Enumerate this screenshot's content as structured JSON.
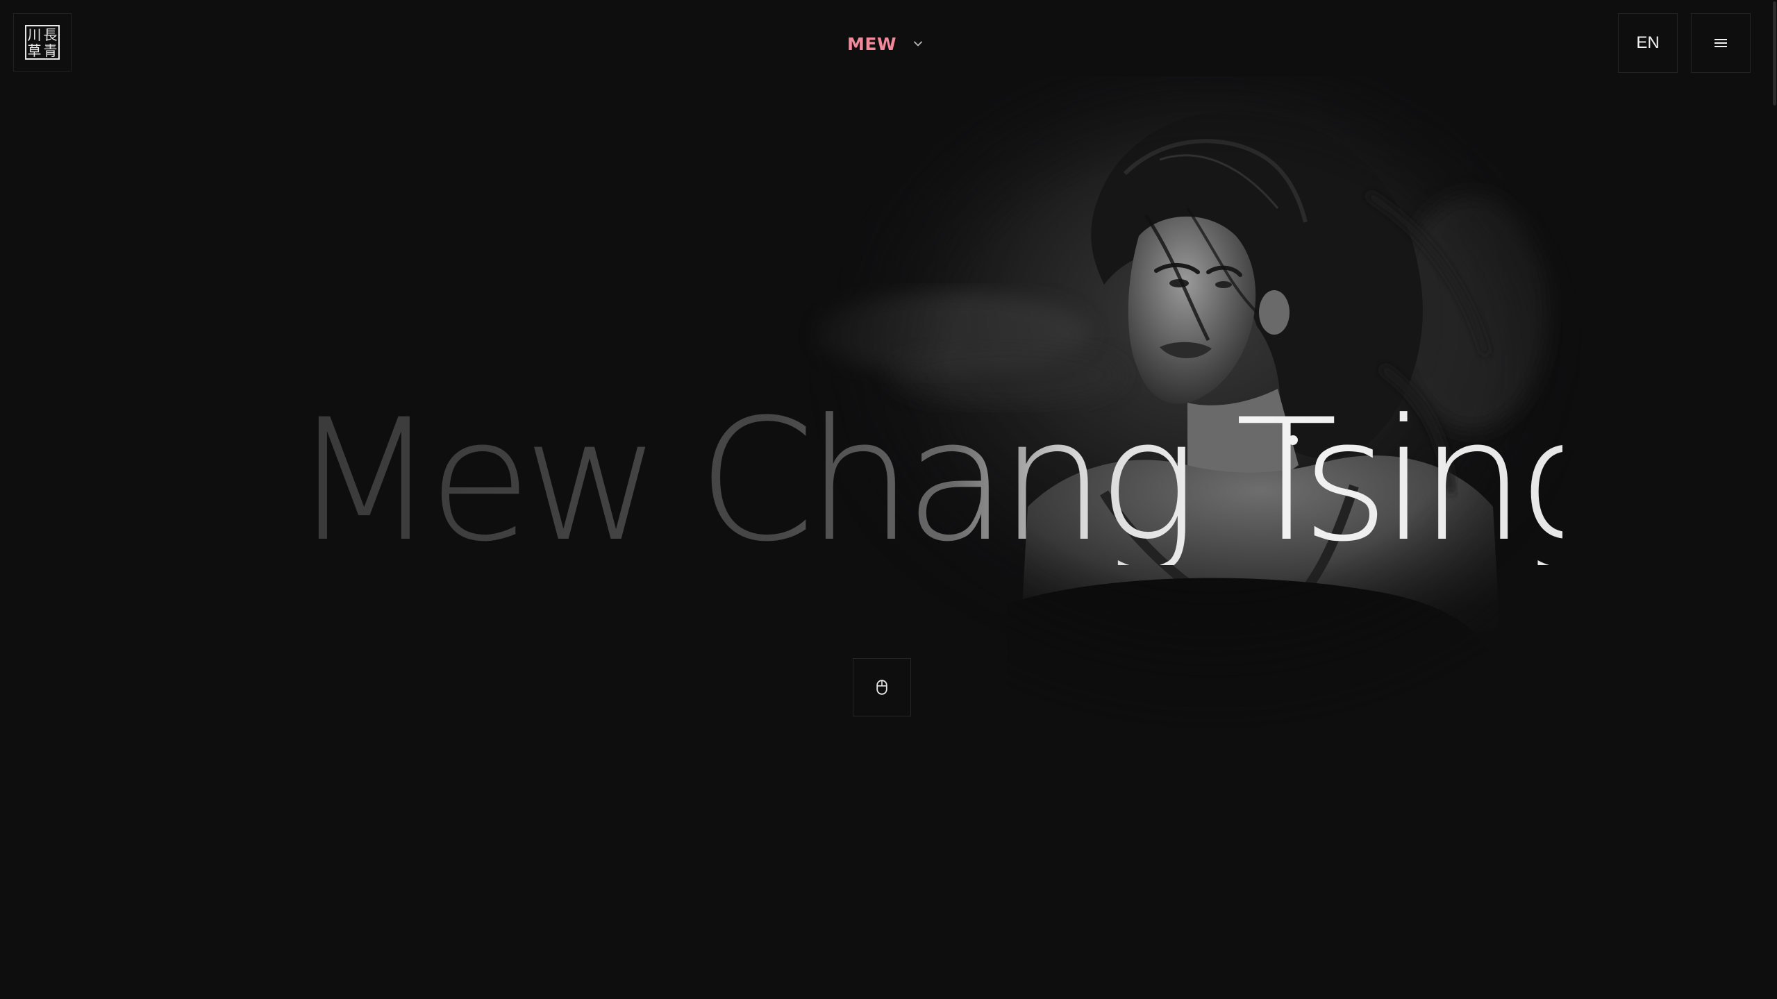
{
  "header": {
    "logo": {
      "seal_chars": [
        "川",
        "長",
        "草",
        "青"
      ],
      "icon": "seal-logo-icon"
    },
    "brand": {
      "label": "MEW",
      "dropdown_icon": "chevron-down-icon"
    },
    "language_button": {
      "label": "EN"
    },
    "menu_button": {
      "icon": "hamburger-menu-icon"
    }
  },
  "hero": {
    "title": "Mew Chang Tsing",
    "portrait": "black-and-white portrait photo",
    "scroll_hint": {
      "icon": "mouse-scroll-icon"
    }
  },
  "colors": {
    "background": "#0e0e0f",
    "brand_accent": "#f08a9a",
    "border": "#232323",
    "text_light": "#f2f2f2"
  }
}
